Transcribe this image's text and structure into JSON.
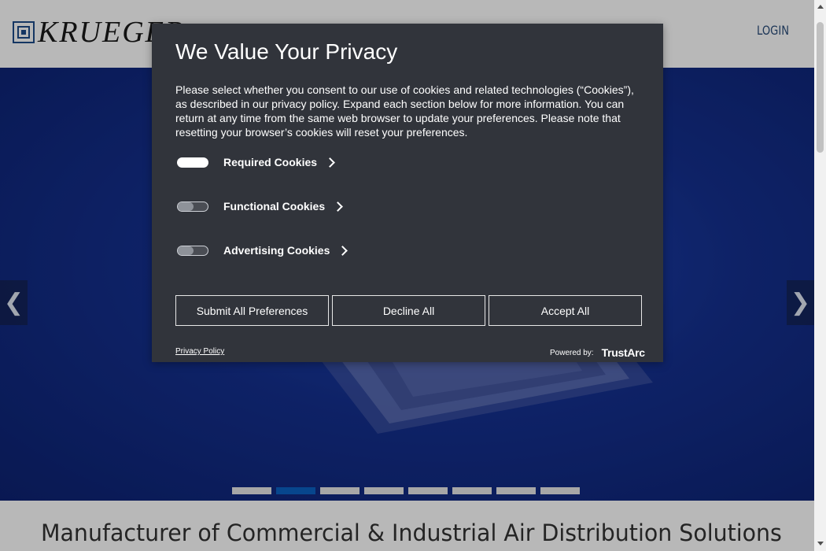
{
  "header": {
    "logo_text": "KRUEGER",
    "login_label": "LOGIN"
  },
  "hero": {
    "prev_arrow": "❮",
    "next_arrow": "❯",
    "slides_count": 8,
    "active_slide": 2
  },
  "headline": "Manufacturer of Commercial & Industrial Air Distribution Solutions",
  "modal": {
    "title": "We Value Your Privacy",
    "description": "Please select whether you consent to our use of cookies and related technologies (“Cookies”), as described in our privacy policy. Expand each section below for more information. You can return at any time from the same web browser to update your preferences. Please note that resetting your browser’s cookies will reset your preferences.",
    "categories": [
      {
        "label": "Required Cookies",
        "enabled": true
      },
      {
        "label": "Functional Cookies",
        "enabled": false
      },
      {
        "label": "Advertising Cookies",
        "enabled": false
      }
    ],
    "buttons": {
      "submit": "Submit All Preferences",
      "decline": "Decline All",
      "accept": "Accept All"
    },
    "privacy_link": "Privacy Policy",
    "powered_by": "Powered by:",
    "powered_brand": "TrustArc"
  },
  "colors": {
    "modal_bg": "#31343b",
    "hero_blue": "#14308f",
    "active_dot": "#0b62c4",
    "login_text": "#2a4d7a"
  }
}
